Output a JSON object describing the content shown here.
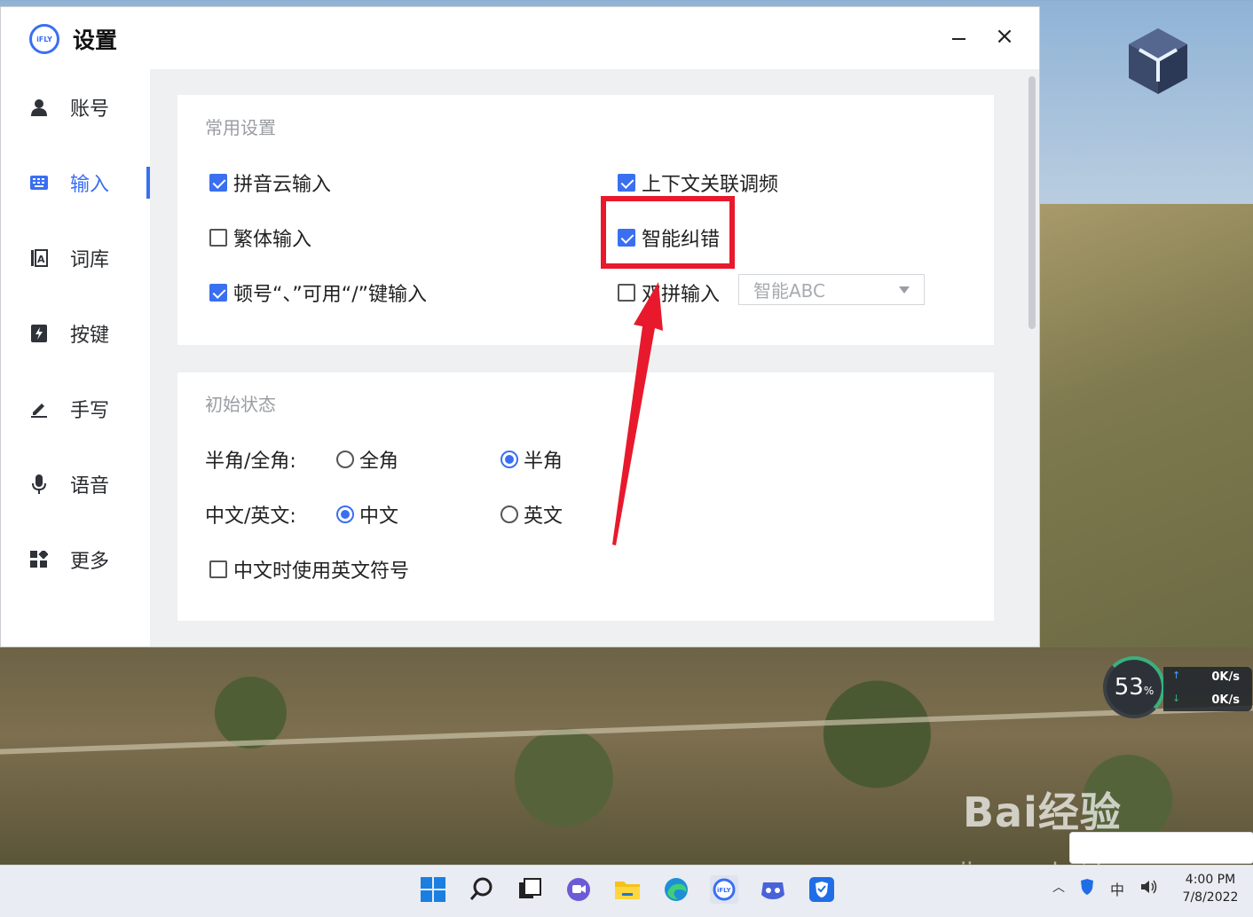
{
  "app": {
    "title": "设置",
    "logo_text": "iFLY"
  },
  "sidebar": {
    "items": [
      {
        "label": "账号",
        "icon": "user-icon"
      },
      {
        "label": "输入",
        "icon": "keyboard-icon",
        "active": true
      },
      {
        "label": "词库",
        "icon": "lexicon-icon"
      },
      {
        "label": "按键",
        "icon": "key-icon"
      },
      {
        "label": "手写",
        "icon": "pen-icon"
      },
      {
        "label": "语音",
        "icon": "mic-icon"
      },
      {
        "label": "更多",
        "icon": "apps-icon"
      }
    ]
  },
  "common": {
    "title": "常用设置",
    "pinyin_cloud": {
      "label": "拼音云输入",
      "checked": true
    },
    "context_freq": {
      "label": "上下文关联调频",
      "checked": true
    },
    "traditional": {
      "label": "繁体输入",
      "checked": false
    },
    "smart_correct": {
      "label": "智能纠错",
      "checked": true
    },
    "comma_slash": {
      "label": "顿号“、”可用“/”键输入",
      "checked": true
    },
    "double_pinyin": {
      "label": "双拼输入",
      "checked": false
    },
    "scheme_select": {
      "value": "智能ABC"
    }
  },
  "initial": {
    "title": "初始状态",
    "width_row": {
      "label": "半角/全角:",
      "full": "全角",
      "half": "半角",
      "selected": "半角"
    },
    "lang_row": {
      "label": "中文/英文:",
      "zh": "中文",
      "en": "英文",
      "selected": "中文"
    },
    "en_punct": {
      "label": "中文时使用英文符号",
      "checked": false
    }
  },
  "widgets": {
    "perf_percent": "53",
    "perf_unit": "%",
    "net_up": "0K/s",
    "net_down": "0K/s"
  },
  "taskbar": {
    "time": "4:00 PM",
    "date": "7/8/2022",
    "ime_indicator": "中"
  },
  "watermark": {
    "logo": "Bai经验",
    "url": "jingyan.baidu.com"
  },
  "colors": {
    "accent": "#3a6ff2",
    "highlight": "#e8192c"
  }
}
